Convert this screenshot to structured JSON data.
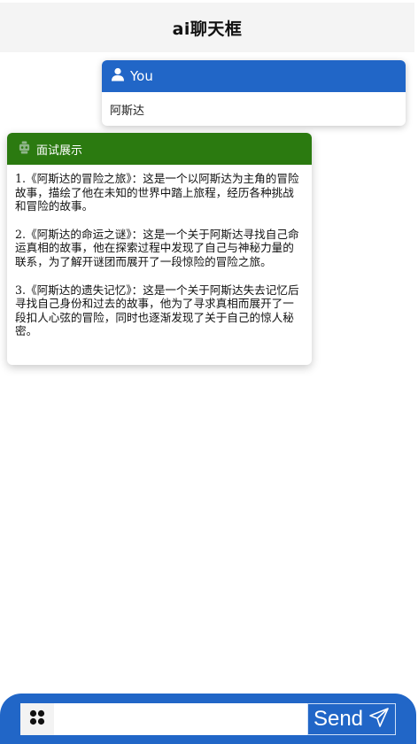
{
  "header": {
    "title": "ai聊天框"
  },
  "user_message": {
    "sender": "You",
    "text": "阿斯达",
    "sender_icon": "person-icon"
  },
  "ai_message": {
    "sender": "面试展示",
    "sender_icon": "bot-icon",
    "paragraphs": [
      "1.《阿斯达的冒险之旅》：这是一个以阿斯达为主角的冒险故事，描绘了他在未知的世界中踏上旅程，经历各种挑战和冒险的故事。",
      "2.《阿斯达的命运之谜》：这是一个关于阿斯达寻找自己命运真相的故事，他在探索过程中发现了自己与神秘力量的联系，为了解开谜团而展开了一段惊险的冒险之旅。",
      "3.《阿斯达的遗失记忆》：这是一个关于阿斯达失去记忆后寻找自己身份和过去的故事，他为了寻求真相而展开了一段扣人心弦的冒险，同时也逐渐发现了关于自己的惊人秘密。"
    ]
  },
  "composer": {
    "input_value": "",
    "send_label": "Send",
    "apps_icon": "apps-icon",
    "send_icon": "paper-plane-icon"
  },
  "colors": {
    "user_bar": "#2166c7",
    "ai_bar": "#2b7a10",
    "footer": "#2166c7"
  }
}
